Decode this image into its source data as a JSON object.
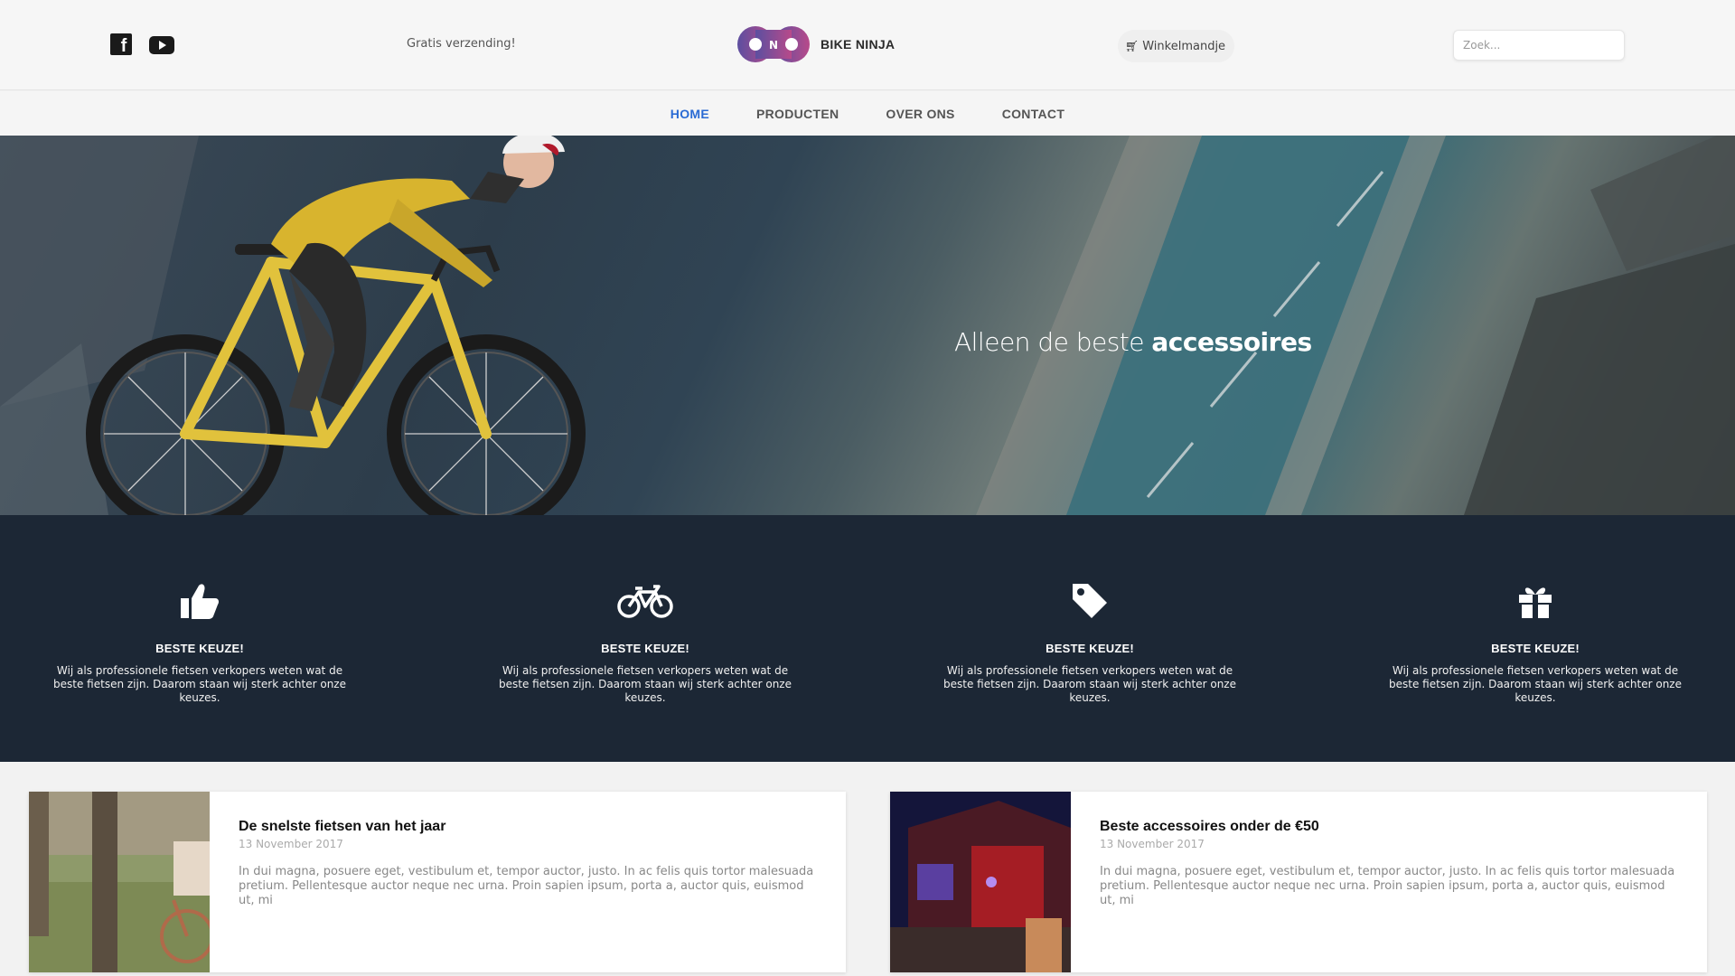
{
  "header": {
    "social": [
      "facebook-icon",
      "youtube-icon"
    ],
    "shipping": "Gratis verzending!",
    "brand": "BIKE NINJA",
    "cart_label": "Winkelmandje",
    "search_placeholder": "Zoek..."
  },
  "nav": {
    "items": [
      {
        "label": "HOME",
        "active": true
      },
      {
        "label": "PRODUCTEN",
        "active": false
      },
      {
        "label": "OVER ONS",
        "active": false
      },
      {
        "label": "CONTACT",
        "active": false
      }
    ]
  },
  "hero": {
    "title_light": "Alleen de beste ",
    "title_bold": "accessoires"
  },
  "features": [
    {
      "icon": "thumbs-up-icon",
      "title": "BESTE KEUZE!",
      "text": "Wij als professionele fietsen verkopers weten wat de beste fietsen zijn. Daarom staan wij sterk achter onze keuzes."
    },
    {
      "icon": "bicycle-icon",
      "title": "BESTE KEUZE!",
      "text": "Wij als professionele fietsen verkopers weten wat de beste fietsen zijn. Daarom staan wij sterk achter onze keuzes."
    },
    {
      "icon": "tag-icon",
      "title": "BESTE KEUZE!",
      "text": "Wij als professionele fietsen verkopers weten wat de beste fietsen zijn. Daarom staan wij sterk achter onze keuzes."
    },
    {
      "icon": "gift-icon",
      "title": "BESTE KEUZE!",
      "text": "Wij als professionele fietsen verkopers weten wat de beste fietsen zijn. Daarom staan wij sterk achter onze keuzes."
    }
  ],
  "posts": [
    {
      "title": "De snelste fietsen van het jaar",
      "date": "13 November 2017",
      "excerpt": "In dui magna, posuere eget, vestibulum et, tempor auctor, justo. In ac felis quis tortor malesuada pretium. Pellentesque auctor neque nec urna. Proin sapien ipsum, porta a, auctor quis, euismod ut, mi"
    },
    {
      "title": "Beste accessoires onder de €50",
      "date": "13 November 2017",
      "excerpt": "In dui magna, posuere eget, vestibulum et, tempor auctor, justo. In ac felis quis tortor malesuada pretium. Pellentesque auctor neque nec urna. Proin sapien ipsum, porta a, auctor quis, euismod ut, mi"
    }
  ],
  "colors": {
    "accent": "#2a6bd4",
    "features_bg": "#1c2735",
    "logo_left": "#5c4fa0",
    "logo_right": "#b84a8a"
  }
}
